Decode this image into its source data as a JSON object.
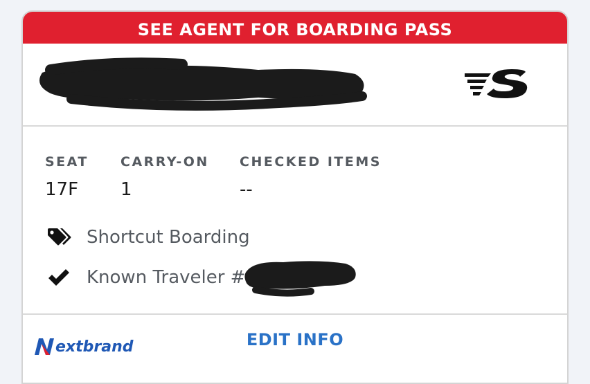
{
  "banner": {
    "text": "SEE AGENT FOR BOARDING PASS",
    "color": "#e0202f"
  },
  "header": {
    "passenger_name": "[redacted]",
    "logo_icon": "airline-logo-icon"
  },
  "details": {
    "seat_label": "SEAT",
    "seat_value": "17F",
    "carryon_label": "CARRY-ON",
    "carryon_value": "1",
    "checked_label": "CHECKED ITEMS",
    "checked_value": "--"
  },
  "features": [
    {
      "icon": "tag-icon",
      "label": "Shortcut Boarding"
    },
    {
      "icon": "checkmark-icon",
      "label": "Known Traveler #"
    }
  ],
  "footer": {
    "edit_label": "EDIT INFO",
    "link_color": "#2a72c7"
  },
  "watermark": {
    "text": "extbrand",
    "logo_letter": "N"
  }
}
